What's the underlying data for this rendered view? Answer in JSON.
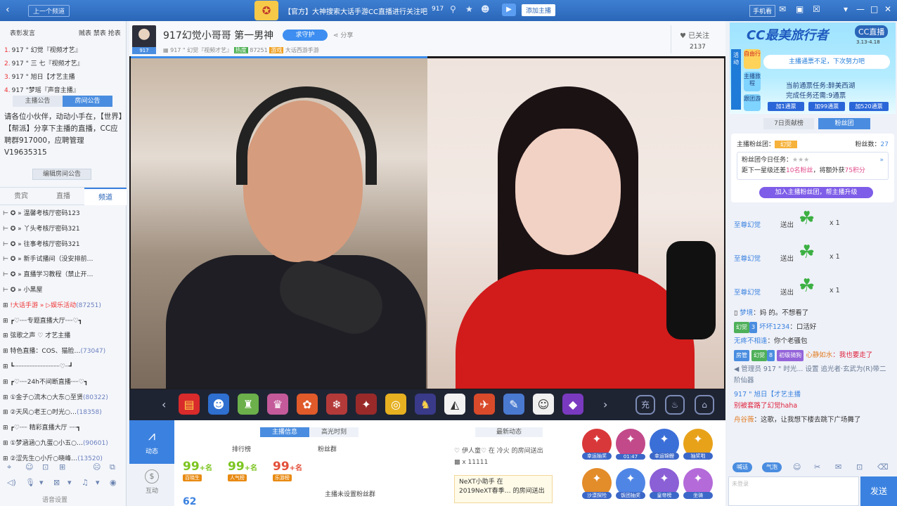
{
  "topbar": {
    "prev_channel": "上一个频道",
    "notice": "【官方】大神搜索大话手游CC直播进行关注吧",
    "viewer_count": "917",
    "add_host": "添加主播",
    "mobile": "手机看"
  },
  "left": {
    "rank_title": "表彰发言",
    "rank_tabs": "贼表 禁表 抢表",
    "rank_items": [
      {
        "n": "1.",
        "name": "917 \" 幻觉『视频才艺』"
      },
      {
        "n": "2.",
        "name": "917 \" 三 七『视频才艺』"
      },
      {
        "n": "3.",
        "name": "917 \" 旭日【才艺主播"
      },
      {
        "n": "4.",
        "name": "917 \"梦瑶『声音主播』"
      }
    ],
    "notice_tabs": [
      "主播公告",
      "房间公告"
    ],
    "notice_text": "请各位小伙伴，动动小手在，【世界】【帮派】分享下主播的直播，CC应聘群917000，应聘管理V19635315",
    "edit_notice": "编辑房间公告",
    "channel_tabs": [
      "贵宾",
      "直播",
      "频道"
    ],
    "channel_items": [
      {
        "text": "温馨考核厅密码123",
        "tag": "",
        "num": ""
      },
      {
        "text": "丫头考核厅密码321",
        "tag": "",
        "num": ""
      },
      {
        "text": "往事考核厅密码321",
        "tag": "",
        "num": ""
      },
      {
        "text": "新手试播间（没安排前…",
        "tag": "",
        "num": ""
      },
      {
        "text": "直播学习教程（禁止开…",
        "tag": "",
        "num": ""
      },
      {
        "text": "小黑屋",
        "tag": "",
        "num": ""
      },
      {
        "text": "大话手游 » ▷娱乐活动",
        "tag": "!",
        "num": "(87251)"
      },
      {
        "text": "┏♡┈┈专题直播大厅┈┈♡┓",
        "tag": "",
        "num": ""
      },
      {
        "text": "弦歌之声  ♡  才艺主播",
        "tag": "",
        "num": ""
      },
      {
        "text": "特色直播：COS、猫脸…",
        "tag": "",
        "num": "(73047)"
      },
      {
        "text": "┗┈┈┈┈┈┈┈┈┈┈┈┈♡┈┛",
        "tag": "",
        "num": ""
      },
      {
        "text": "┏♡┈┈24h不间断直播┈┈♡┓",
        "tag": "",
        "num": ""
      },
      {
        "text": "①金子○流木○大东○至贤",
        "tag": "",
        "num": "(80322)"
      },
      {
        "text": "②天风○老王○时光○…",
        "tag": "",
        "num": "(18358)"
      },
      {
        "text": "┏♡┈┈ 精彩直播大厅 ┈┈┓",
        "tag": "",
        "num": ""
      },
      {
        "text": "①梦涵涵○九蛋○小五○…",
        "tag": "",
        "num": "(90601)"
      },
      {
        "text": "②涩先生○小斤○晓峰…",
        "tag": "",
        "num": "(13520)"
      }
    ],
    "voice_settings": "语音设置"
  },
  "room": {
    "id": "917",
    "title": "917幻觉小哥哥   第一男神",
    "guard": "求守护",
    "share": "分享",
    "subline_name": "917 \" 幻觉『视频才艺』",
    "hot": "热度",
    "hot_value": "87251",
    "game": "游戏",
    "game_name": "大话西游手游",
    "followed": "已关注",
    "follow_count": "2137"
  },
  "info": {
    "nav_dynamic": "动态",
    "nav_interact": "互动",
    "tabs": [
      "主播信息",
      "高光时刻"
    ],
    "rank_label": "排行榜",
    "fans_label": "粉丝群",
    "badges": [
      {
        "value": "99",
        "suffix": "+名",
        "label": "百晓生",
        "color": "#7cc520"
      },
      {
        "value": "99",
        "suffix": "+名",
        "label": "人气榜",
        "color": "#7cc520"
      },
      {
        "value": "99",
        "suffix": "+名",
        "label": "乐游榜",
        "color": "#e3503a"
      }
    ],
    "no_fans": "主播未设置粉丝群",
    "cut_num": "62",
    "latest": "最新动态",
    "news1_a": "伊人童♡",
    "news1_b": "在 冷火",
    "news1_c": "的房间送出",
    "news1_d": "x 11111",
    "news2_a": "NeXT小助手",
    "news2_b": "在",
    "news2_c": "2019NeXT春季…",
    "news2_d": "的房间送出",
    "activities": [
      {
        "label": "幸运抽奖",
        "color": "#d9383a"
      },
      {
        "label": "01:47",
        "color": "#c24a8a"
      },
      {
        "label": "幸运锦鲤",
        "color": "#3b6fd8"
      },
      {
        "label": "抽奖啦",
        "color": "#e8a21a"
      },
      {
        "label": "沙漠探险",
        "color": "#e38c2a"
      },
      {
        "label": "饭团抽奖",
        "color": "#4f86e6"
      },
      {
        "label": "皇帝榜",
        "color": "#8b5fd6"
      },
      {
        "label": "坐骑",
        "color": "#b46ad9"
      }
    ]
  },
  "right": {
    "promo_title": "CC最美旅行者",
    "promo_brand": "CC直播",
    "promo_date": "3.13-4.18",
    "promo_side": "活动",
    "promo_sq1": "自由行",
    "promo_sq2": "主播旅程",
    "promo_sq3": "跟团游",
    "promo_banner": "主播通票不足，下次努力吧",
    "promo_task1": "当前通票任务:醉美西湖",
    "promo_task2": "完成任务还需:9通票",
    "promo_buttons": [
      "加1通票",
      "加99通票",
      "加520通票"
    ],
    "fan_tabs": [
      "7日贡献榜",
      "粉丝团"
    ],
    "fan_label": "主播粉丝团：",
    "fan_level": "幻觉",
    "fan_count_label": "粉丝数：",
    "fan_count": "27",
    "fan_task": "粉丝团今日任务：",
    "fan_gap_a": "距下一星级还差",
    "fan_gap_b": "10名粉丝",
    "fan_gap_c": "，将额外获",
    "fan_gap_d": "75积分",
    "fan_join": "加入主播粉丝团，帮主播升级",
    "gifts": [
      {
        "who": "至尊幻觉",
        "send": "送出",
        "x": "x 1"
      },
      {
        "who": "至尊幻觉",
        "send": "送出",
        "x": "x 1"
      },
      {
        "who": "至尊幻觉",
        "send": "送出",
        "x": "x 1"
      }
    ],
    "msg1_user": "梦境",
    "msg1_text": "：妈 的。不想看了",
    "msg2_tag": "幻觉",
    "msg2_lvl": "3",
    "msg2_user": "坏坏1234",
    "msg2_text": "：口活好",
    "msg3_user": "无疼不相逢",
    "msg3_text": "：你个老骚包",
    "msg4_tag1": "房管",
    "msg4_tag2": "幻觉",
    "msg4_lvl": "8",
    "msg4_tag3": "初级骑狗",
    "msg4_user": "心静如水",
    "msg4_text": "：我也要走了",
    "msg5_text": "管理员 917 \" 时光... 设置 追光者·玄武为(R)带二阶仙器",
    "msg6_user": "917 \" 旭日【才艺主播",
    "msg6_text": "别被套路了幻觉haha",
    "msg7_user": "舟谷薇",
    "msg7_text": "：这歌，让我想下楼去跳下广场舞了",
    "chat_tools": [
      "喊话",
      "气泡"
    ],
    "input_placeholder": "未登录",
    "send": "发送"
  }
}
